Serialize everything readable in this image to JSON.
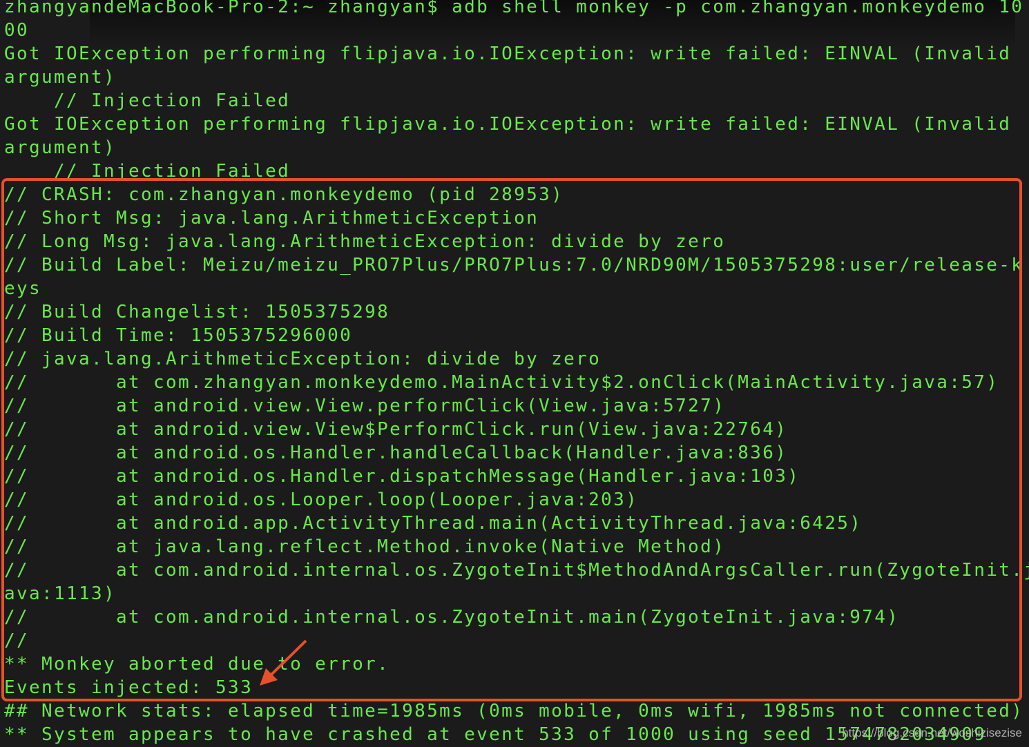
{
  "terminal": {
    "lines": [
      "zhangyandeMacBook-Pro-2:~ zhangyan$ adb shell monkey -p com.zhangyan.monkeydemo 10",
      "00",
      "Got IOException performing flipjava.io.IOException: write failed: EINVAL (Invalid",
      "argument)",
      "    // Injection Failed",
      "Got IOException performing flipjava.io.IOException: write failed: EINVAL (Invalid",
      "argument)",
      "    // Injection Failed",
      "// CRASH: com.zhangyan.monkeydemo (pid 28953)",
      "// Short Msg: java.lang.ArithmeticException",
      "// Long Msg: java.lang.ArithmeticException: divide by zero",
      "// Build Label: Meizu/meizu_PRO7Plus/PRO7Plus:7.0/NRD90M/1505375298:user/release-k",
      "eys",
      "// Build Changelist: 1505375298",
      "// Build Time: 1505375296000",
      "// java.lang.ArithmeticException: divide by zero",
      "//       at com.zhangyan.monkeydemo.MainActivity$2.onClick(MainActivity.java:57)",
      "//       at android.view.View.performClick(View.java:5727)",
      "//       at android.view.View$PerformClick.run(View.java:22764)",
      "//       at android.os.Handler.handleCallback(Handler.java:836)",
      "//       at android.os.Handler.dispatchMessage(Handler.java:103)",
      "//       at android.os.Looper.loop(Looper.java:203)",
      "//       at android.app.ActivityThread.main(ActivityThread.java:6425)",
      "//       at java.lang.reflect.Method.invoke(Native Method)",
      "//       at com.android.internal.os.ZygoteInit$MethodAndArgsCaller.run(ZygoteInit.j",
      "ava:1113)",
      "//       at com.android.internal.os.ZygoteInit.main(ZygoteInit.java:974)",
      "//",
      "** Monkey aborted due to error.",
      "Events injected: 533",
      "## Network stats: elapsed time=1985ms (0ms mobile, 0ms wifi, 1985ms not connected)",
      "** System appears to have crashed at event 533 of 1000 using seed 1574782034909"
    ]
  },
  "watermark": "https://blog.csdn.net/woshizisezise",
  "colors": {
    "text": "#6ae84c",
    "background": "#1b1b1b",
    "highlight": "#e8502a"
  }
}
